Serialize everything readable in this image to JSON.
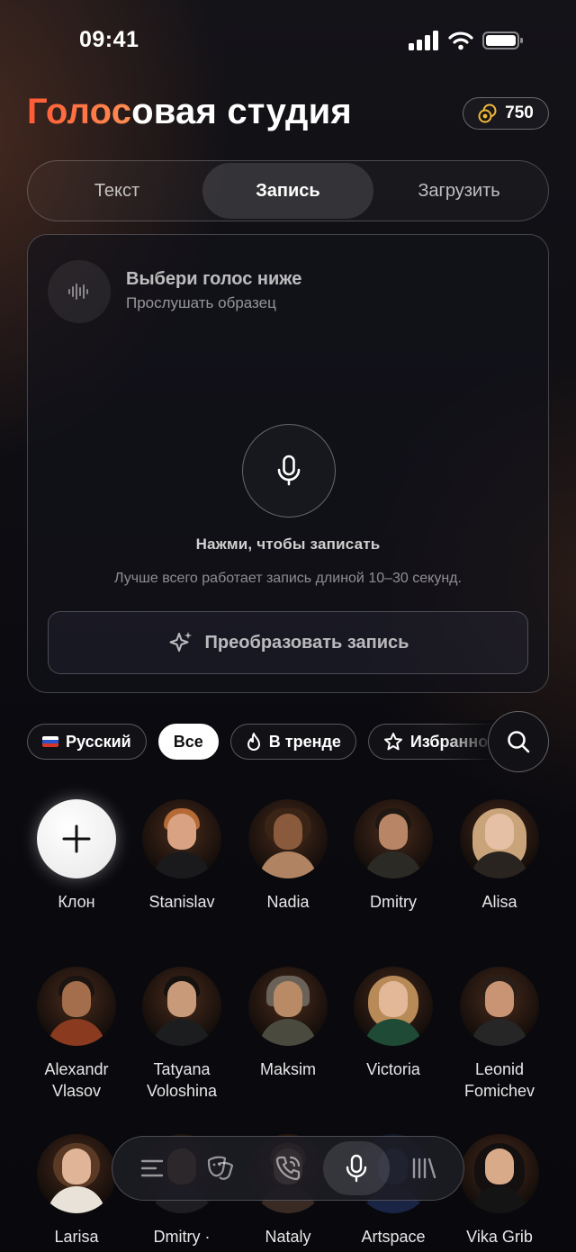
{
  "status": {
    "time": "09:41"
  },
  "header": {
    "title_highlight": "Голос",
    "title_rest": "овая студия",
    "credits": "750"
  },
  "tabs": [
    {
      "label": "Текст",
      "active": false
    },
    {
      "label": "Запись",
      "active": true
    },
    {
      "label": "Загрузить",
      "active": false
    }
  ],
  "card": {
    "voice_title": "Выбери голос ниже",
    "voice_subtitle": "Прослушать образец",
    "tap_label": "Нажми, чтобы записать",
    "hint": "Лучше всего работает запись длиной 10–30 секунд.",
    "convert_label": "Преобразовать запись"
  },
  "filters": [
    {
      "label": "Русский",
      "icon": "russia-flag-icon",
      "active": false
    },
    {
      "label": "Все",
      "active": true
    },
    {
      "label": "В тренде",
      "icon": "fire-icon",
      "active": false
    },
    {
      "label": "Избранное",
      "icon": "star-icon",
      "active": false
    }
  ],
  "voices": [
    {
      "name": "Клон",
      "clone": true
    },
    {
      "name": "Stanislav"
    },
    {
      "name": "Nadia"
    },
    {
      "name": "Dmitry"
    },
    {
      "name": "Alisa"
    },
    {
      "name": "Alexandr Vlasov"
    },
    {
      "name": "Tatyana Voloshina"
    },
    {
      "name": "Maksim"
    },
    {
      "name": "Victoria"
    },
    {
      "name": "Leonid Fomichev"
    },
    {
      "name": "Larisa"
    },
    {
      "name": "Dmitry ·"
    },
    {
      "name": "Nataly"
    },
    {
      "name": "Artspace"
    },
    {
      "name": "Vika Grib"
    }
  ],
  "nav": [
    {
      "icon": "menu-icon",
      "active": false
    },
    {
      "icon": "theater-masks-icon",
      "active": false
    },
    {
      "icon": "phone-call-icon",
      "active": false
    },
    {
      "icon": "microphone-icon",
      "active": true
    },
    {
      "icon": "library-icon",
      "active": false
    }
  ],
  "colors": {
    "accent": "#ff6a3d",
    "background": "#0b0b10",
    "coin": "#f0b93a"
  }
}
